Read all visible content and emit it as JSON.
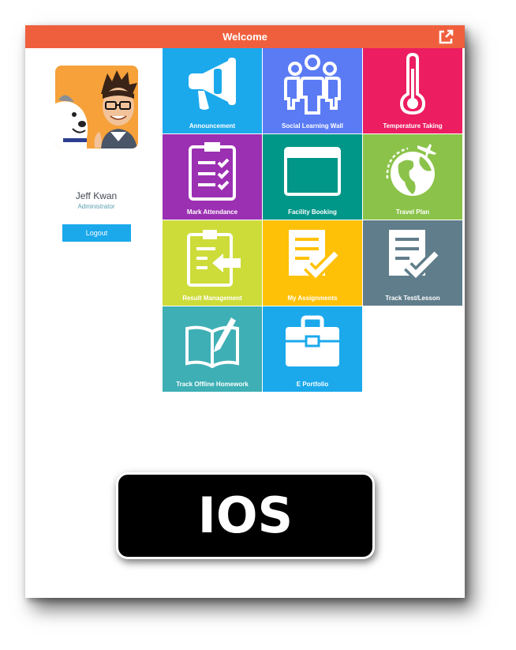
{
  "header": {
    "title": "Welcome",
    "export_icon": "external-link-icon"
  },
  "profile": {
    "name": "Jeff Kwan",
    "role": "Administrator",
    "logout_label": "Logout"
  },
  "tiles": [
    {
      "label": "Announcement",
      "icon": "megaphone-icon",
      "color": "#1ba9ec"
    },
    {
      "label": "Social Learning Wall",
      "icon": "group-icon",
      "color": "#5b7bf5"
    },
    {
      "label": "Temperature Taking",
      "icon": "thermometer-icon",
      "color": "#ec1d61"
    },
    {
      "label": "Mark Attendance",
      "icon": "clipboard-checklist-icon",
      "color": "#9b30b2"
    },
    {
      "label": "Facility Booking",
      "icon": "browser-window-icon",
      "color": "#009688"
    },
    {
      "label": "Travel Plan",
      "icon": "globe-plane-icon",
      "color": "#8bc34a"
    },
    {
      "label": "Result Management",
      "icon": "clipboard-arrow-icon",
      "color": "#cddc39"
    },
    {
      "label": "My Assignments",
      "icon": "checklist-icon",
      "color": "#ffc107"
    },
    {
      "label": "Track Test/Lesson",
      "icon": "checklist-icon",
      "color": "#607d8b"
    },
    {
      "label": "Track Offline Homework",
      "icon": "book-pen-icon",
      "color": "#3eafb5"
    },
    {
      "label": "E Portfolio",
      "icon": "briefcase-icon",
      "color": "#1ba9ec"
    }
  ],
  "badge": {
    "text": "IOS"
  }
}
